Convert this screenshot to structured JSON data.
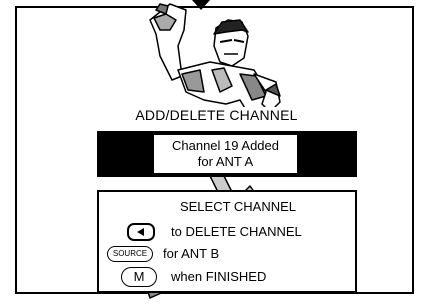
{
  "screen": {
    "title": "ADD/DELETE CHANNEL",
    "status_line1": "Channel 19 Added",
    "status_line2": "for ANT A"
  },
  "options": {
    "header": "SELECT CHANNEL",
    "items": [
      {
        "key_icon": "left-arrow-key",
        "key_label": "",
        "text": "to DELETE CHANNEL"
      },
      {
        "key_icon": "source-key",
        "key_label": "SOURCE",
        "text": "for ANT B"
      },
      {
        "key_icon": "menu-key",
        "key_label": "M",
        "text": "when FINISHED"
      }
    ]
  }
}
